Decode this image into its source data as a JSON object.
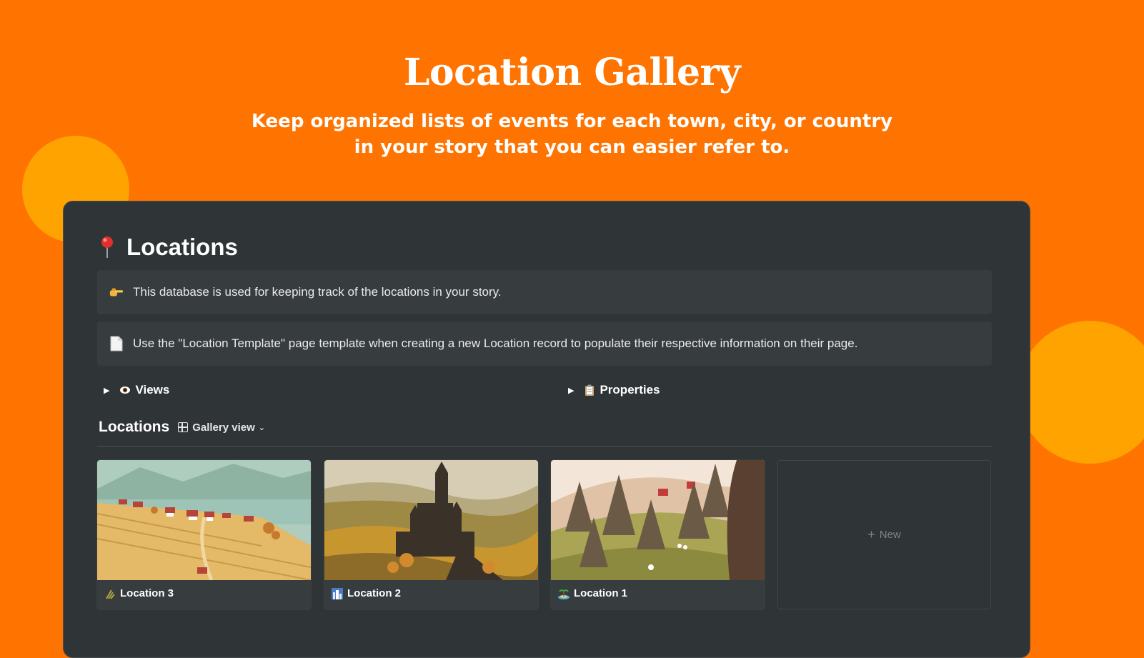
{
  "hero": {
    "title": "Location Gallery",
    "subtitle_line1": "Keep organized lists of events for each town, city, or country",
    "subtitle_line2": "in your story that you can easier refer to."
  },
  "colors": {
    "background": "#FF7300",
    "bubble": "#FFA300",
    "panel": "#2F3437",
    "callout": "#373C3F"
  },
  "page": {
    "icon": "pushpin-icon",
    "title": "Locations",
    "callouts": [
      {
        "icon": "pointing-hand-icon",
        "text": "This database is used for keeping track of the locations in your story."
      },
      {
        "icon": "page-icon",
        "text": "Use the \"Location Template\" page template when creating a new Location record to populate their respective information on their page."
      }
    ],
    "toggles": [
      {
        "icon": "eye-icon",
        "label": "Views"
      },
      {
        "icon": "clipboard-icon",
        "label": "Properties"
      }
    ]
  },
  "database": {
    "title": "Locations",
    "view_label": "Gallery view",
    "cards": [
      {
        "icon": "wheat-icon",
        "title": "Location 3"
      },
      {
        "icon": "cityscape-icon",
        "title": "Location 2"
      },
      {
        "icon": "island-icon",
        "title": "Location 1"
      }
    ],
    "new_label": "New"
  }
}
